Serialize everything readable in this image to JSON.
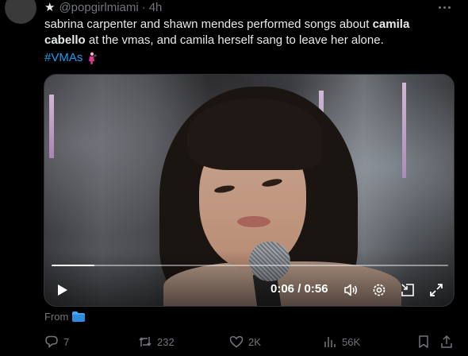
{
  "tweet": {
    "header_star": "★",
    "handle": "@popgirlmiami",
    "separator": "·",
    "time": "4h",
    "text_part1": "sabrina carpenter and shawn mendes performed songs about ",
    "text_bold": "camila cabello",
    "text_part2": " at the vmas, and camila herself sang to leave her alone.",
    "hashtag": "#VMAs",
    "hashtag_emoji": "singer-emoji-icon"
  },
  "video": {
    "time_display": "0:06 / 0:56",
    "progress": 0.107,
    "controls": [
      "play-icon",
      "volume-icon",
      "settings-gear-icon",
      "picture-in-picture-icon",
      "fullscreen-expand-icon"
    ]
  },
  "source": {
    "from_label": "From",
    "folder_icon": "folder-icon"
  },
  "actions": {
    "replies": "7",
    "reposts": "232",
    "likes": "2K",
    "views": "56K"
  },
  "colors": {
    "background": "#000000",
    "text": "#e7e9ea",
    "muted": "#71767b",
    "link": "#1d9bf0"
  }
}
